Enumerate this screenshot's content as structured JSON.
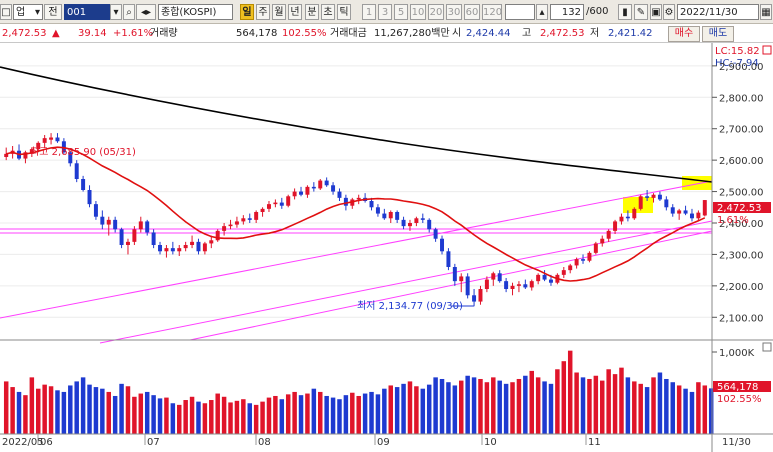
{
  "toolbar": {
    "market_select": "업",
    "market_arrow": "▾",
    "mode_label": "전",
    "code_value": "001",
    "index_name": "종합(KOSPI)",
    "period_buttons": [
      "일",
      "주",
      "월",
      "년",
      "분",
      "초",
      "틱"
    ],
    "selected_period": "일",
    "interval_buttons": [
      "1",
      "3",
      "5",
      "10",
      "20",
      "30",
      "60",
      "120"
    ],
    "count_value": "132",
    "count_total": "/600",
    "date_value": "2022/11/30",
    "icons": [
      "search-icon",
      "speaker-icon",
      "candle-icon",
      "tool-icon",
      "save-icon",
      "gear-icon",
      "calendar-icon"
    ]
  },
  "quote": {
    "price": "2,472.53",
    "price_arrow": "▲",
    "change": "39.14",
    "change_pct": "+1.61%",
    "volume_label": "거래량",
    "volume": "564,178",
    "volume_ratio": "102.55%",
    "amount_label": "거래대금",
    "amount": "11,267,280백만",
    "open_label": "시",
    "open": "2,424.44",
    "high_label": "고",
    "high": "2,472.53",
    "low_label": "저",
    "low": "2,421.42",
    "buy_button": "매수",
    "sell_button": "매도"
  },
  "chart_data": {
    "type": "candlestick",
    "price_axis": {
      "ticks": [
        "2,900.00",
        "2,800.00",
        "2,700.00",
        "2,600.00",
        "2,500.00",
        "2,400.00",
        "2,300.00",
        "2,200.00",
        "2,100.00"
      ],
      "tick_values": [
        2900,
        2800,
        2700,
        2600,
        2500,
        2400,
        2300,
        2200,
        2100
      ],
      "range": [
        2050,
        2960
      ]
    },
    "top_labels": {
      "lc": "LC:15.82",
      "hc": "HC:-7.94"
    },
    "current_price_label": "2,472.53",
    "current_pct_label": "1.61%",
    "high_annotation": "최고 2,685.90 (05/31)",
    "low_annotation": "최저 2,134.77 (09/30)",
    "volume_axis": {
      "tick": "1,000K",
      "tick_value": 1000,
      "range": [
        0,
        1100
      ]
    },
    "volume_label": "564,178",
    "volume_pct_label": "102.55%",
    "x_labels": [
      "2022/05",
      "06",
      "07",
      "08",
      "09",
      "10",
      "11",
      "11/30"
    ],
    "colors": {
      "up": "#e0142a",
      "down": "#1e3ad0",
      "ma": "#e01010",
      "long_ma": "#000000",
      "channel": "#ff40ff",
      "highlight": "#ffff00"
    },
    "candles": [
      [
        2610,
        2640,
        2600,
        2620
      ],
      [
        2620,
        2645,
        2605,
        2630
      ],
      [
        2630,
        2650,
        2600,
        2605
      ],
      [
        2605,
        2630,
        2590,
        2625
      ],
      [
        2620,
        2640,
        2610,
        2635
      ],
      [
        2635,
        2660,
        2625,
        2655
      ],
      [
        2655,
        2680,
        2640,
        2670
      ],
      [
        2665,
        2686,
        2650,
        2672
      ],
      [
        2672,
        2686,
        2655,
        2660
      ],
      [
        2660,
        2670,
        2620,
        2625
      ],
      [
        2625,
        2630,
        2580,
        2590
      ],
      [
        2590,
        2600,
        2530,
        2540
      ],
      [
        2540,
        2550,
        2500,
        2505
      ],
      [
        2505,
        2520,
        2450,
        2460
      ],
      [
        2460,
        2470,
        2410,
        2420
      ],
      [
        2420,
        2440,
        2380,
        2395
      ],
      [
        2395,
        2420,
        2360,
        2410
      ],
      [
        2410,
        2420,
        2370,
        2380
      ],
      [
        2380,
        2385,
        2320,
        2330
      ],
      [
        2330,
        2350,
        2300,
        2340
      ],
      [
        2340,
        2390,
        2330,
        2380
      ],
      [
        2380,
        2420,
        2370,
        2405
      ],
      [
        2405,
        2410,
        2360,
        2370
      ],
      [
        2370,
        2380,
        2320,
        2330
      ],
      [
        2330,
        2340,
        2300,
        2310
      ],
      [
        2310,
        2330,
        2290,
        2320
      ],
      [
        2320,
        2340,
        2300,
        2310
      ],
      [
        2310,
        2330,
        2295,
        2320
      ],
      [
        2320,
        2340,
        2310,
        2330
      ],
      [
        2330,
        2360,
        2320,
        2340
      ],
      [
        2340,
        2350,
        2300,
        2310
      ],
      [
        2310,
        2340,
        2300,
        2335
      ],
      [
        2335,
        2360,
        2320,
        2345
      ],
      [
        2345,
        2380,
        2340,
        2375
      ],
      [
        2375,
        2400,
        2360,
        2390
      ],
      [
        2390,
        2410,
        2380,
        2395
      ],
      [
        2395,
        2420,
        2385,
        2405
      ],
      [
        2405,
        2425,
        2395,
        2415
      ],
      [
        2415,
        2430,
        2400,
        2410
      ],
      [
        2410,
        2440,
        2400,
        2435
      ],
      [
        2435,
        2450,
        2420,
        2445
      ],
      [
        2445,
        2470,
        2435,
        2460
      ],
      [
        2460,
        2475,
        2450,
        2465
      ],
      [
        2465,
        2480,
        2445,
        2455
      ],
      [
        2455,
        2490,
        2450,
        2485
      ],
      [
        2485,
        2510,
        2475,
        2500
      ],
      [
        2500,
        2515,
        2485,
        2490
      ],
      [
        2490,
        2520,
        2480,
        2515
      ],
      [
        2515,
        2530,
        2500,
        2510
      ],
      [
        2510,
        2540,
        2505,
        2535
      ],
      [
        2535,
        2545,
        2515,
        2520
      ],
      [
        2520,
        2530,
        2490,
        2500
      ],
      [
        2500,
        2510,
        2470,
        2480
      ],
      [
        2480,
        2490,
        2440,
        2455
      ],
      [
        2455,
        2480,
        2445,
        2475
      ],
      [
        2475,
        2490,
        2460,
        2480
      ],
      [
        2480,
        2495,
        2465,
        2470
      ],
      [
        2470,
        2480,
        2440,
        2450
      ],
      [
        2450,
        2460,
        2420,
        2430
      ],
      [
        2430,
        2445,
        2410,
        2415
      ],
      [
        2415,
        2440,
        2400,
        2435
      ],
      [
        2435,
        2440,
        2400,
        2410
      ],
      [
        2410,
        2420,
        2380,
        2390
      ],
      [
        2390,
        2410,
        2375,
        2400
      ],
      [
        2400,
        2420,
        2390,
        2415
      ],
      [
        2415,
        2430,
        2400,
        2410
      ],
      [
        2410,
        2415,
        2370,
        2380
      ],
      [
        2380,
        2385,
        2340,
        2350
      ],
      [
        2350,
        2360,
        2300,
        2310
      ],
      [
        2310,
        2320,
        2250,
        2260
      ],
      [
        2260,
        2270,
        2200,
        2215
      ],
      [
        2215,
        2240,
        2180,
        2230
      ],
      [
        2230,
        2240,
        2160,
        2170
      ],
      [
        2170,
        2190,
        2135,
        2150
      ],
      [
        2150,
        2200,
        2140,
        2190
      ],
      [
        2190,
        2230,
        2180,
        2220
      ],
      [
        2220,
        2245,
        2200,
        2240
      ],
      [
        2240,
        2250,
        2210,
        2215
      ],
      [
        2215,
        2225,
        2180,
        2190
      ],
      [
        2190,
        2210,
        2170,
        2200
      ],
      [
        2200,
        2215,
        2180,
        2205
      ],
      [
        2205,
        2220,
        2190,
        2195
      ],
      [
        2195,
        2220,
        2185,
        2215
      ],
      [
        2215,
        2240,
        2205,
        2235
      ],
      [
        2235,
        2250,
        2215,
        2220
      ],
      [
        2220,
        2235,
        2200,
        2210
      ],
      [
        2210,
        2240,
        2205,
        2235
      ],
      [
        2235,
        2260,
        2225,
        2250
      ],
      [
        2250,
        2270,
        2240,
        2265
      ],
      [
        2265,
        2290,
        2255,
        2285
      ],
      [
        2285,
        2300,
        2270,
        2280
      ],
      [
        2280,
        2310,
        2275,
        2305
      ],
      [
        2305,
        2340,
        2300,
        2335
      ],
      [
        2335,
        2360,
        2325,
        2350
      ],
      [
        2350,
        2380,
        2340,
        2375
      ],
      [
        2375,
        2410,
        2365,
        2405
      ],
      [
        2405,
        2430,
        2395,
        2420
      ],
      [
        2420,
        2440,
        2405,
        2415
      ],
      [
        2415,
        2450,
        2410,
        2445
      ],
      [
        2445,
        2490,
        2440,
        2485
      ],
      [
        2485,
        2505,
        2470,
        2480
      ],
      [
        2480,
        2495,
        2465,
        2490
      ],
      [
        2490,
        2500,
        2470,
        2475
      ],
      [
        2475,
        2485,
        2440,
        2450
      ],
      [
        2450,
        2460,
        2420,
        2430
      ],
      [
        2430,
        2445,
        2410,
        2440
      ],
      [
        2440,
        2455,
        2425,
        2430
      ],
      [
        2430,
        2445,
        2405,
        2415
      ],
      [
        2415,
        2440,
        2405,
        2433
      ],
      [
        2424,
        2473,
        2421,
        2473
      ]
    ],
    "volumes": [
      650,
      580,
      520,
      480,
      700,
      560,
      610,
      590,
      540,
      520,
      600,
      650,
      700,
      610,
      580,
      560,
      520,
      470,
      620,
      590,
      460,
      500,
      520,
      480,
      440,
      450,
      380,
      360,
      420,
      460,
      400,
      380,
      420,
      500,
      460,
      390,
      410,
      430,
      380,
      360,
      400,
      450,
      470,
      430,
      490,
      520,
      480,
      500,
      560,
      520,
      470,
      450,
      430,
      480,
      510,
      470,
      500,
      520,
      490,
      560,
      600,
      580,
      620,
      650,
      590,
      560,
      610,
      700,
      680,
      640,
      600,
      660,
      720,
      700,
      680,
      640,
      700,
      660,
      620,
      640,
      680,
      720,
      780,
      700,
      650,
      620,
      800,
      900,
      1030,
      760,
      700,
      680,
      720,
      660,
      800,
      740,
      820,
      700,
      650,
      620,
      580,
      700,
      760,
      680,
      640,
      600,
      560,
      520,
      640,
      600,
      564
    ]
  }
}
